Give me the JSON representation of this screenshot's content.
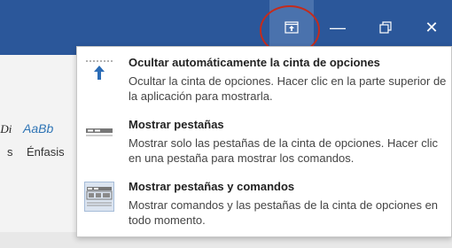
{
  "titlebar": {
    "buttons": [
      {
        "name": "ribbon-display-options",
        "icon": "ribbon-display-options-icon"
      },
      {
        "name": "minimize",
        "icon": "minimize-icon",
        "glyph": "—"
      },
      {
        "name": "restore",
        "icon": "restore-icon"
      },
      {
        "name": "close",
        "icon": "close-icon",
        "glyph": "✕"
      }
    ],
    "accent_color": "#2b579a",
    "annotation_color": "#c42b1c"
  },
  "ribbon": {
    "style_samples": [
      "̱:Di",
      "AaBb"
    ],
    "style_names": [
      "s",
      "Énfasis"
    ]
  },
  "menu": {
    "items": [
      {
        "icon": "auto-hide-ribbon-icon",
        "title": "Ocultar automáticamente la cinta de opciones",
        "description": "Ocultar la cinta de opciones. Hacer clic en la parte superior de la aplicación para mostrarla."
      },
      {
        "icon": "show-tabs-icon",
        "title": "Mostrar pestañas",
        "description": "Mostrar solo las pestañas de la cinta de opciones. Hacer clic en una pestaña para mostrar los comandos."
      },
      {
        "icon": "show-tabs-and-commands-icon",
        "title": "Mostrar pestañas y comandos",
        "description": "Mostrar comandos y las pestañas de la cinta de opciones en todo momento.",
        "selected": true
      }
    ]
  }
}
